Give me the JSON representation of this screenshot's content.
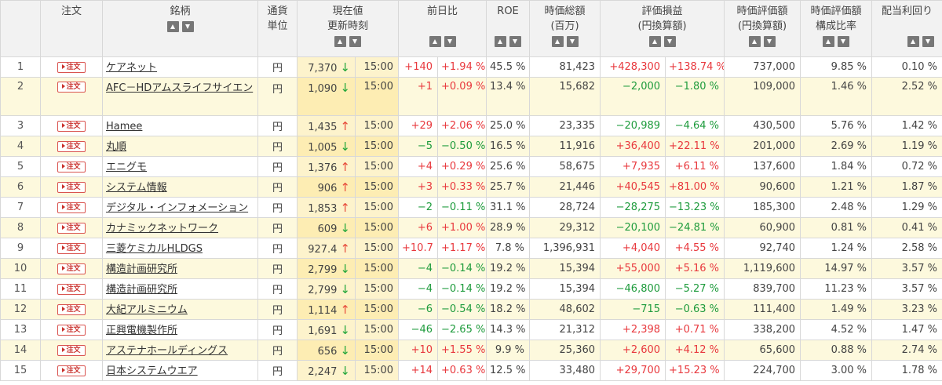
{
  "header": {
    "col_index": "",
    "col_order": "注文",
    "col_name": "銘柄",
    "col_currency": [
      "通貨",
      "単位"
    ],
    "col_price": [
      "現在値",
      "更新時刻"
    ],
    "col_change": "前日比",
    "col_roe": "ROE",
    "col_mktcap": [
      "時価総額",
      "(百万)"
    ],
    "col_pl": [
      "評価損益",
      "(円換算額)"
    ],
    "col_value": [
      "時価評価額",
      "(円換算額)"
    ],
    "col_ratio": [
      "時価評価額",
      "構成比率"
    ],
    "col_yield": "配当利回り"
  },
  "order_label": "注文",
  "colors": {
    "positive": "#e8383d",
    "negative": "#1e9b3c",
    "current_bg": "#fdedb3",
    "alt_row_bg": "#fdf9dd"
  },
  "rows": [
    {
      "no": "1",
      "name": "ケアネット",
      "currency": "円",
      "price": "7,370",
      "dir": "down",
      "time": "15:00",
      "chg": "+140",
      "chg_pct": "+1.94 %",
      "roe": "45.5 %",
      "mktcap": "81,423",
      "pl": "+428,300",
      "pl_pct": "+138.74 %",
      "value": "737,000",
      "ratio": "9.85 %",
      "yield": "0.10 %"
    },
    {
      "no": "2",
      "name": "AFC－HDアムスライフサイエン",
      "currency": "円",
      "price": "1,090",
      "dir": "down",
      "time": "15:00",
      "chg": "+1",
      "chg_pct": "+0.09 %",
      "roe": "13.4 %",
      "mktcap": "15,682",
      "pl": "−2,000",
      "pl_pct": "−1.80 %",
      "value": "109,000",
      "ratio": "1.46 %",
      "yield": "2.52 %"
    },
    {
      "no": "3",
      "name": "Hamee",
      "currency": "円",
      "price": "1,435",
      "dir": "up",
      "time": "15:00",
      "chg": "+29",
      "chg_pct": "+2.06 %",
      "roe": "25.0 %",
      "mktcap": "23,335",
      "pl": "−20,989",
      "pl_pct": "−4.64 %",
      "value": "430,500",
      "ratio": "5.76 %",
      "yield": "1.42 %"
    },
    {
      "no": "4",
      "name": "丸順",
      "currency": "円",
      "price": "1,005",
      "dir": "down",
      "time": "15:00",
      "chg": "−5",
      "chg_pct": "−0.50 %",
      "roe": "16.5 %",
      "mktcap": "11,916",
      "pl": "+36,400",
      "pl_pct": "+22.11 %",
      "value": "201,000",
      "ratio": "2.69 %",
      "yield": "1.19 %"
    },
    {
      "no": "5",
      "name": "エニグモ",
      "currency": "円",
      "price": "1,376",
      "dir": "up",
      "time": "15:00",
      "chg": "+4",
      "chg_pct": "+0.29 %",
      "roe": "25.6 %",
      "mktcap": "58,675",
      "pl": "+7,935",
      "pl_pct": "+6.11 %",
      "value": "137,600",
      "ratio": "1.84 %",
      "yield": "0.72 %"
    },
    {
      "no": "6",
      "name": "システム情報",
      "currency": "円",
      "price": "906",
      "dir": "up",
      "time": "15:00",
      "chg": "+3",
      "chg_pct": "+0.33 %",
      "roe": "25.7 %",
      "mktcap": "21,446",
      "pl": "+40,545",
      "pl_pct": "+81.00 %",
      "value": "90,600",
      "ratio": "1.21 %",
      "yield": "1.87 %"
    },
    {
      "no": "7",
      "name": "デジタル・インフォメーション",
      "currency": "円",
      "price": "1,853",
      "dir": "up",
      "time": "15:00",
      "chg": "−2",
      "chg_pct": "−0.11 %",
      "roe": "31.1 %",
      "mktcap": "28,724",
      "pl": "−28,275",
      "pl_pct": "−13.23 %",
      "value": "185,300",
      "ratio": "2.48 %",
      "yield": "1.29 %"
    },
    {
      "no": "8",
      "name": "カナミックネットワーク",
      "currency": "円",
      "price": "609",
      "dir": "down",
      "time": "15:00",
      "chg": "+6",
      "chg_pct": "+1.00 %",
      "roe": "28.9 %",
      "mktcap": "29,312",
      "pl": "−20,100",
      "pl_pct": "−24.81 %",
      "value": "60,900",
      "ratio": "0.81 %",
      "yield": "0.41 %"
    },
    {
      "no": "9",
      "name": "三菱ケミカルHLDGS",
      "currency": "円",
      "price": "927.4",
      "dir": "up",
      "time": "15:00",
      "chg": "+10.7",
      "chg_pct": "+1.17 %",
      "roe": "7.8 %",
      "mktcap": "1,396,931",
      "pl": "+4,040",
      "pl_pct": "+4.55 %",
      "value": "92,740",
      "ratio": "1.24 %",
      "yield": "2.58 %"
    },
    {
      "no": "10",
      "name": "構造計画研究所",
      "currency": "円",
      "price": "2,799",
      "dir": "down",
      "time": "15:00",
      "chg": "−4",
      "chg_pct": "−0.14 %",
      "roe": "19.2 %",
      "mktcap": "15,394",
      "pl": "+55,000",
      "pl_pct": "+5.16 %",
      "value": "1,119,600",
      "ratio": "14.97 %",
      "yield": "3.57 %"
    },
    {
      "no": "11",
      "name": "構造計画研究所",
      "currency": "円",
      "price": "2,799",
      "dir": "down",
      "time": "15:00",
      "chg": "−4",
      "chg_pct": "−0.14 %",
      "roe": "19.2 %",
      "mktcap": "15,394",
      "pl": "−46,800",
      "pl_pct": "−5.27 %",
      "value": "839,700",
      "ratio": "11.23 %",
      "yield": "3.57 %"
    },
    {
      "no": "12",
      "name": "大紀アルミニウム",
      "currency": "円",
      "price": "1,114",
      "dir": "up",
      "time": "15:00",
      "chg": "−6",
      "chg_pct": "−0.54 %",
      "roe": "18.2 %",
      "mktcap": "48,602",
      "pl": "−715",
      "pl_pct": "−0.63 %",
      "value": "111,400",
      "ratio": "1.49 %",
      "yield": "3.23 %"
    },
    {
      "no": "13",
      "name": "正興電機製作所",
      "currency": "円",
      "price": "1,691",
      "dir": "down",
      "time": "15:00",
      "chg": "−46",
      "chg_pct": "−2.65 %",
      "roe": "14.3 %",
      "mktcap": "21,312",
      "pl": "+2,398",
      "pl_pct": "+0.71 %",
      "value": "338,200",
      "ratio": "4.52 %",
      "yield": "1.47 %"
    },
    {
      "no": "14",
      "name": "アステナホールディングス",
      "currency": "円",
      "price": "656",
      "dir": "down",
      "time": "15:00",
      "chg": "+10",
      "chg_pct": "+1.55 %",
      "roe": "9.9 %",
      "mktcap": "25,360",
      "pl": "+2,600",
      "pl_pct": "+4.12 %",
      "value": "65,600",
      "ratio": "0.88 %",
      "yield": "2.74 %"
    },
    {
      "no": "15",
      "name": "日本システムウエア",
      "currency": "円",
      "price": "2,247",
      "dir": "down",
      "time": "15:00",
      "chg": "+14",
      "chg_pct": "+0.63 %",
      "roe": "12.5 %",
      "mktcap": "33,480",
      "pl": "+29,700",
      "pl_pct": "+15.23 %",
      "value": "224,700",
      "ratio": "3.00 %",
      "yield": "1.78 %"
    }
  ]
}
